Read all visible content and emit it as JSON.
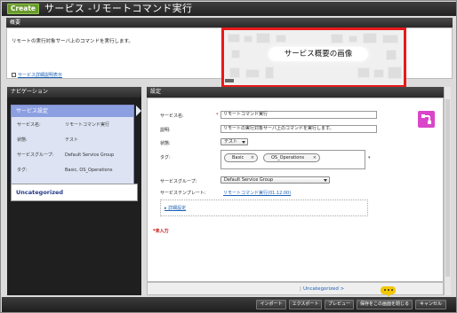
{
  "titlebar": {
    "create_label": "Create",
    "title": "サービス -リモートコマンド実行"
  },
  "overview": {
    "header": "概要",
    "description": "リモートの実行対象サーバ上のコマンドを実行します。",
    "image_label": "サービス概要の画像",
    "detail_link": "サービス詳細説明表示"
  },
  "nav": {
    "header": "ナビゲーション",
    "card_title": "サービス設定",
    "rows": [
      {
        "key": "サービス名:",
        "value": "リモートコマンド実行"
      },
      {
        "key": "状態:",
        "value": "テスト"
      },
      {
        "key": "サービスグループ:",
        "value": "Default Service Group"
      },
      {
        "key": "タグ:",
        "value": "Basic, OS_Operations"
      }
    ],
    "uncategorized": "Uncategorized"
  },
  "settings": {
    "header": "設定",
    "service_name_label": "サービス名:",
    "required_mark": "*",
    "service_name_value": "リモートコマンド実行",
    "description_label": "説明:",
    "description_value": "リモートの実行対象サーバ上のコマンドを実行します。",
    "status_label": "状態:",
    "status_value": "テスト",
    "tag_label": "タグ:",
    "tags": [
      "Basic",
      "OS_Operations"
    ],
    "tag_remove": "×",
    "group_label": "サービスグループ:",
    "group_value": "Default Service Group",
    "template_label": "サービステンプレート:",
    "template_value": "リモートコマンド実行(01.12.00)",
    "detail_settings": "詳細設定",
    "required_note": "*未入力",
    "footer_pipe": "|",
    "footer_link": "Uncategorized >"
  },
  "bottom_buttons": [
    "インポート",
    "エクスポート",
    "プレビュー",
    "保存をこの画面を閉じる",
    "キャンセル"
  ]
}
